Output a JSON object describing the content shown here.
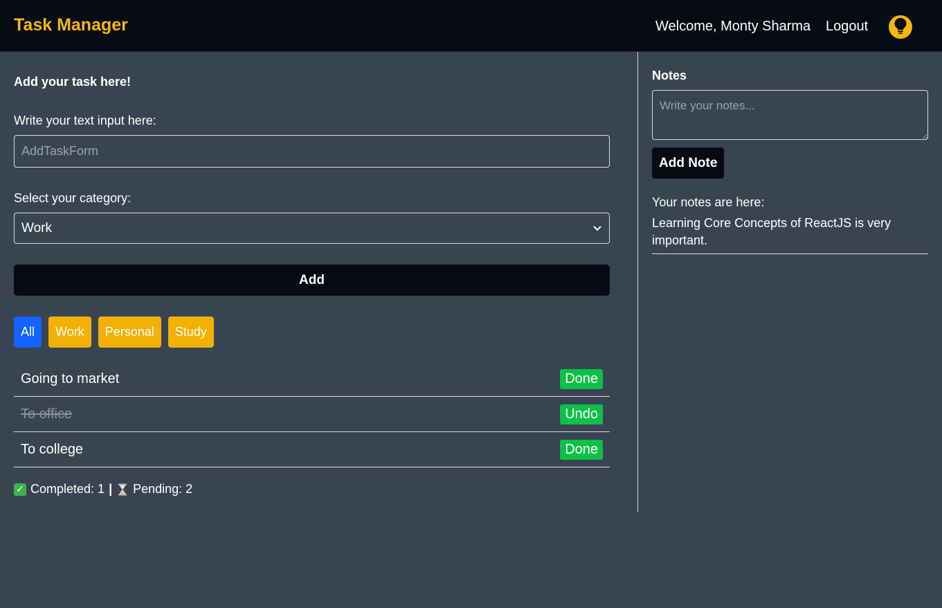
{
  "header": {
    "brand": "Task Manager",
    "welcome": "Welcome, Monty Sharma",
    "logout": "Logout",
    "theme_icon": "lightbulb-icon",
    "accent_color": "#f5b70b"
  },
  "task_form": {
    "title": "Add your task here!",
    "text_label": "Write your text input here:",
    "text_placeholder": "AddTaskForm",
    "category_label": "Select your category:",
    "category_selected": "Work",
    "add_label": "Add"
  },
  "filters": [
    {
      "label": "All",
      "active": true
    },
    {
      "label": "Work",
      "active": false
    },
    {
      "label": "Personal",
      "active": false
    },
    {
      "label": "Study",
      "active": false
    }
  ],
  "tasks": [
    {
      "text": "Going to market",
      "completed": false,
      "action": "Done"
    },
    {
      "text": "To office",
      "completed": true,
      "action": "Undo"
    },
    {
      "text": "To college",
      "completed": false,
      "action": "Done"
    }
  ],
  "summary": {
    "completed_label": "Completed: 1",
    "separator": "|",
    "pending_label": "Pending: 2"
  },
  "notes": {
    "title": "Notes",
    "placeholder": "Write your notes...",
    "add_label": "Add Note",
    "list_heading": "Your notes are here:",
    "items": [
      "Learning Core Concepts of ReactJS is very important."
    ]
  }
}
